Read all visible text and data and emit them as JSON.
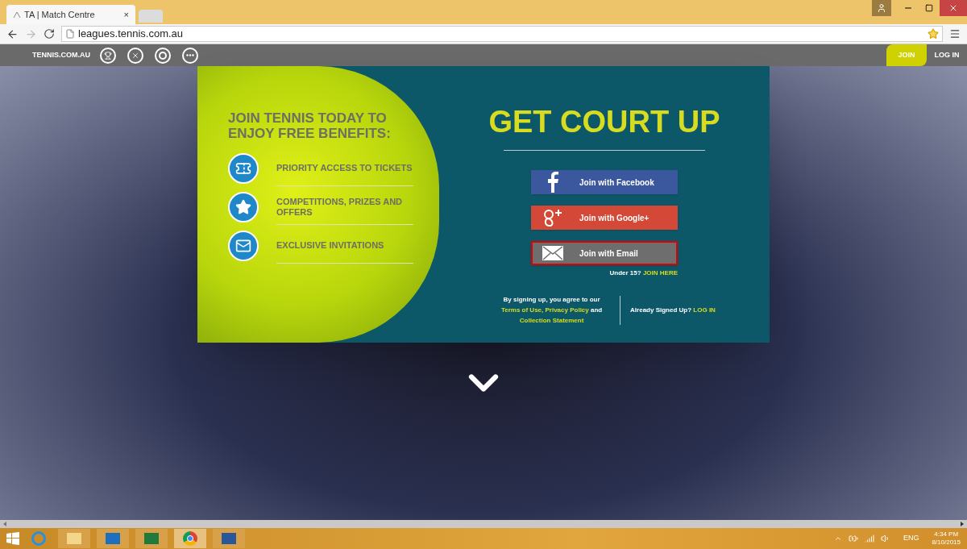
{
  "browser": {
    "tab": {
      "title": "TA | Match Centre",
      "close": "×"
    },
    "url": "leagues.tennis.com.au"
  },
  "site_nav": {
    "brand": "TENNIS.COM.AU",
    "tabs": [
      {
        "label": "JOIN",
        "selected": true
      },
      {
        "label": "LOG IN",
        "selected": false
      }
    ]
  },
  "hero": {
    "heading": "JOIN TENNIS TODAY TO ENJOY FREE BENEFITS:",
    "benefits": [
      {
        "kind": "ticket",
        "label": "PRIORITY ACCESS TO TICKETS"
      },
      {
        "kind": "star",
        "label": "COMPETITIONS, PRIZES AND OFFERS"
      },
      {
        "kind": "mail",
        "label": "EXCLUSIVE INVITATIONS"
      }
    ],
    "title": "GET COURT UP",
    "buttons": [
      {
        "kind": "facebook",
        "label": "Join with Facebook",
        "selected": false
      },
      {
        "kind": "google",
        "label": "Join with Google+",
        "selected": false
      },
      {
        "kind": "email",
        "label": "Join with Email",
        "selected": true
      }
    ],
    "under15": {
      "text": "Under 15?",
      "link": "JOIN HERE"
    },
    "agreement": [
      {
        "kind": "text",
        "text": "By signing up, you agree to our"
      },
      {
        "kind": "link",
        "text": "Terms of Use,"
      },
      {
        "kind": "link",
        "text": "Privacy Policy"
      },
      {
        "kind": "text",
        "text": "and"
      },
      {
        "kind": "link",
        "text": "Collection Statement"
      }
    ],
    "signed_up": {
      "text": "Already Signed Up?",
      "link": "LOG IN"
    }
  },
  "taskbar": {
    "language": "ENG",
    "time": "4:34 PM",
    "date": "8/10/2015"
  }
}
